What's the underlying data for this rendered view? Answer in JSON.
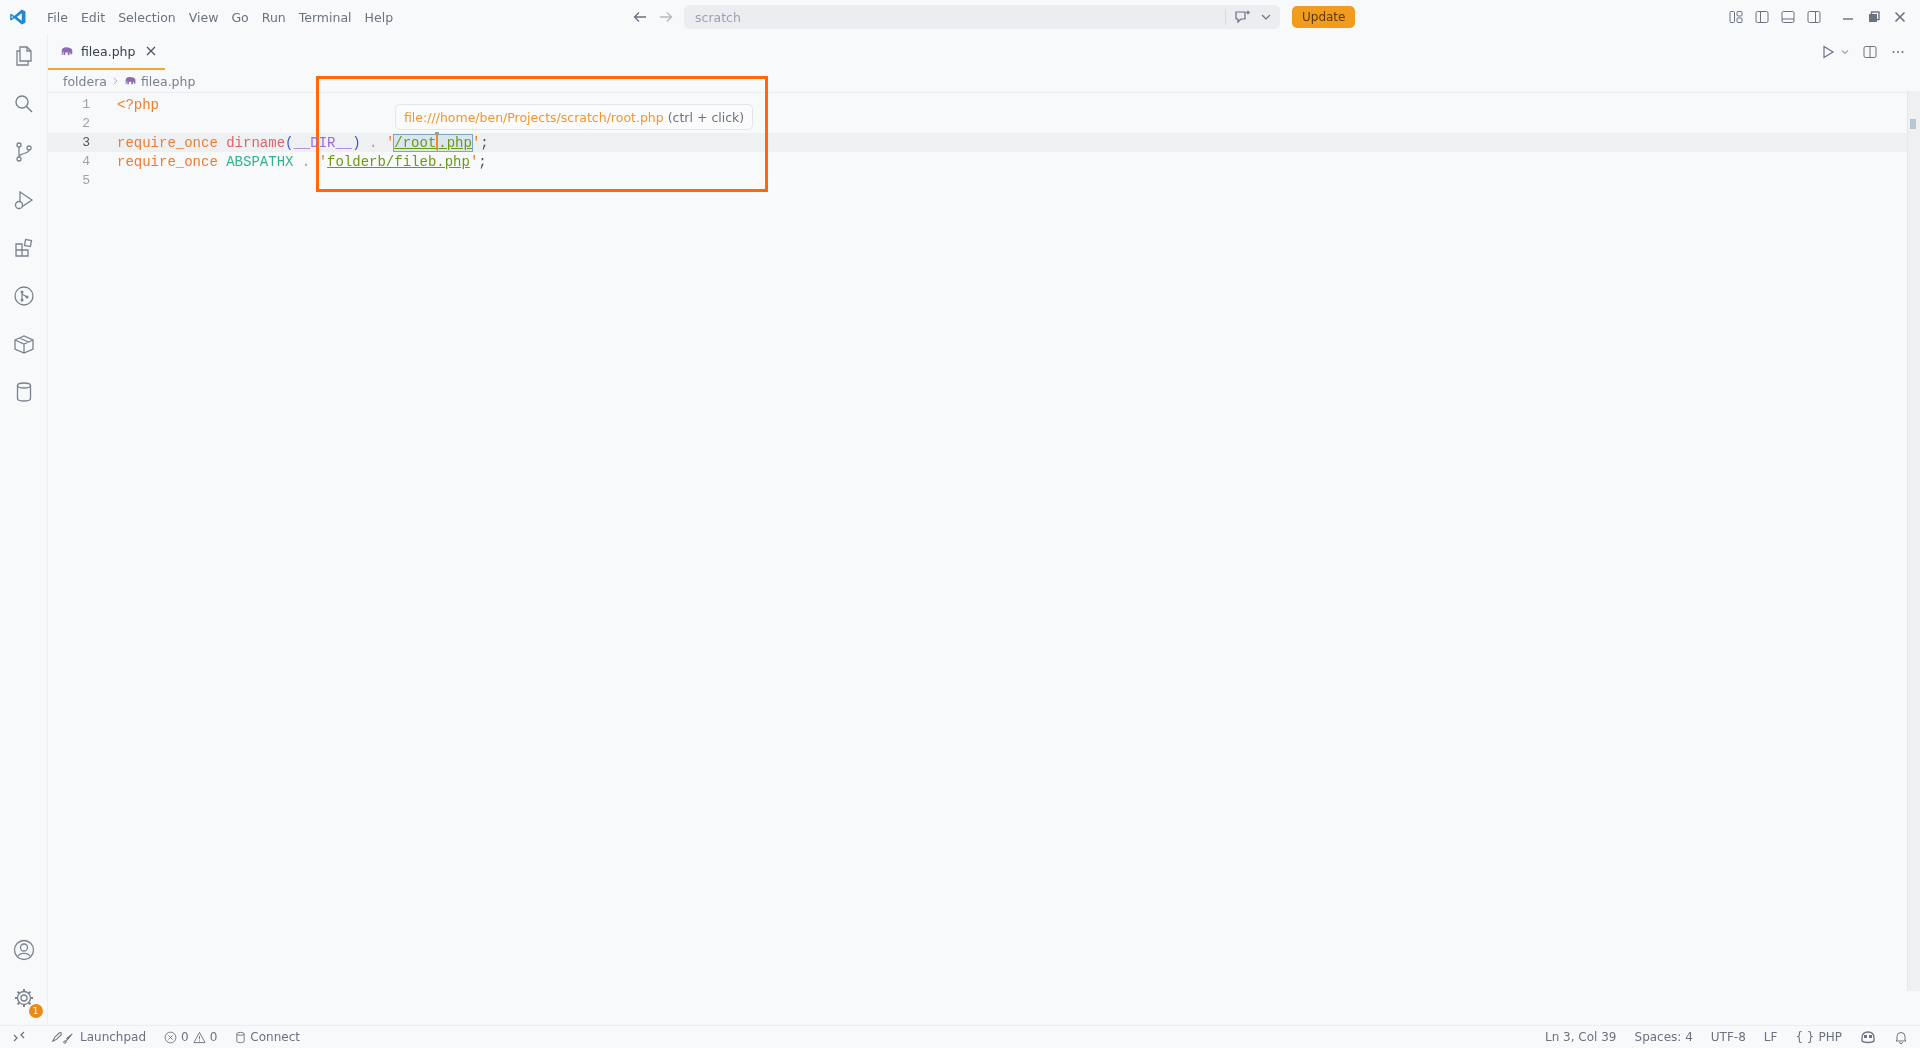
{
  "title_bar": {
    "menu": [
      "File",
      "Edit",
      "Selection",
      "View",
      "Go",
      "Run",
      "Terminal",
      "Help"
    ],
    "command_center": "scratch",
    "update_button": "Update"
  },
  "activity_bar": {
    "settings_badge": "1"
  },
  "tabs": [
    {
      "label": "filea.php",
      "selected": true
    }
  ],
  "breadcrumb": [
    "foldera",
    "filea.php"
  ],
  "editor": {
    "lines": [
      {
        "number": "1",
        "current": false,
        "tokens": [
          {
            "kind": "tag",
            "text": "<?php",
            "caret_after": false
          }
        ]
      },
      {
        "number": "2",
        "current": false
      },
      {
        "number": "3",
        "current": true,
        "tokens": [
          {
            "kind": "keyword",
            "text": "require_once ",
            "caret_after": false
          },
          {
            "kind": "function",
            "text": "dirname",
            "caret_after": false
          },
          {
            "kind": "paren",
            "text": "(",
            "caret_after": false
          },
          {
            "kind": "magic",
            "text": "__DIR__",
            "caret_after": false
          },
          {
            "kind": "paren",
            "text": ")",
            "caret_after": false
          },
          {
            "kind": "op",
            "text": " . ",
            "caret_after": false
          },
          {
            "kind": "quote",
            "text": "'",
            "caret_after": false
          },
          {
            "kind": "link-hover",
            "text": "/root",
            "caret_after": true
          },
          {
            "kind": "link-hover",
            "text": ".php",
            "caret_after": false
          },
          {
            "kind": "quote",
            "text": "'",
            "caret_after": false
          },
          {
            "kind": "plain",
            "text": ";",
            "caret_after": false
          }
        ]
      },
      {
        "number": "4",
        "current": false,
        "tokens": [
          {
            "kind": "keyword",
            "text": "require_once ",
            "caret_after": false
          },
          {
            "kind": "constant",
            "text": "ABSPATHX",
            "caret_after": false
          },
          {
            "kind": "op",
            "text": " . ",
            "caret_after": false
          },
          {
            "kind": "quote",
            "text": "'",
            "caret_after": false
          },
          {
            "kind": "link",
            "text": "folderb/fileb.php",
            "caret_after": false
          },
          {
            "kind": "quote",
            "text": "'",
            "caret_after": false
          },
          {
            "kind": "plain",
            "text": ";",
            "caret_after": false
          }
        ]
      },
      {
        "number": "5",
        "current": false
      }
    ]
  },
  "hover": {
    "link": "file:///home/ben/Projects/scratch/root.php",
    "hint": "(ctrl + click)"
  },
  "status_bar": {
    "launchpad": "Launchpad",
    "errors": "0",
    "warnings": "0",
    "connect": "Connect",
    "position": "Ln 3, Col 39",
    "indentation": "Spaces: 4",
    "encoding": "UTF-8",
    "eol": "LF",
    "language_braces": "{ }",
    "language": "PHP"
  }
}
